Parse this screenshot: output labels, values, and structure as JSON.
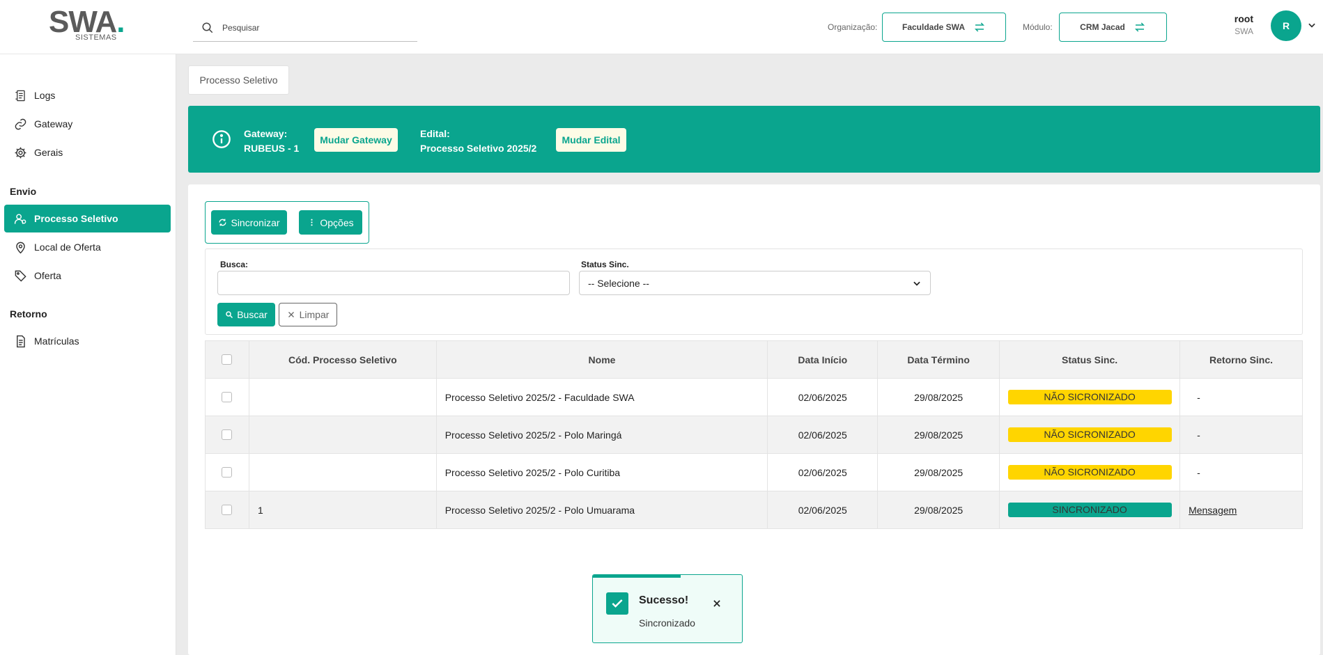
{
  "header": {
    "logo_text": "SWA",
    "logo_sub": "SISTEMAS",
    "search_placeholder": "Pesquisar",
    "org_label": "Organização:",
    "org_value": "Faculdade SWA",
    "module_label": "Módulo:",
    "module_value": "CRM Jacad",
    "user_name": "root",
    "user_org": "SWA",
    "avatar_initial": "R"
  },
  "sidebar": {
    "items_top": [
      {
        "label": "Logs",
        "icon": "logs-icon"
      },
      {
        "label": "Gateway",
        "icon": "link-icon"
      },
      {
        "label": "Gerais",
        "icon": "gear-icon"
      }
    ],
    "section_envio": "Envio",
    "items_envio": [
      {
        "label": "Processo Seletivo",
        "icon": "users-icon",
        "active": true
      },
      {
        "label": "Local de Oferta",
        "icon": "location-icon"
      },
      {
        "label": "Oferta",
        "icon": "tag-icon"
      }
    ],
    "section_retorno": "Retorno",
    "items_retorno": [
      {
        "label": "Matrículas",
        "icon": "document-icon"
      }
    ]
  },
  "main": {
    "tab_label": "Processo Seletivo",
    "banner": {
      "gateway_label": "Gateway:",
      "gateway_value": "RUBEUS - 1",
      "change_gateway": "Mudar Gateway",
      "edital_label": "Edital:",
      "edital_value": "Processo Seletivo 2025/2",
      "change_edital": "Mudar Edital"
    },
    "toolbar": {
      "sync_label": "Sincronizar",
      "options_label": "Opções"
    },
    "filter": {
      "search_label": "Busca:",
      "search_value": "",
      "status_label": "Status Sinc.",
      "status_value": "-- Selecione --",
      "search_button": "Buscar",
      "clear_button": "Limpar"
    },
    "table": {
      "columns": [
        "Cód. Processo Seletivo",
        "Nome",
        "Data Início",
        "Data Término",
        "Status Sinc.",
        "Retorno Sinc."
      ],
      "rows": [
        {
          "code": "",
          "name": "Processo Seletivo 2025/2 - Faculdade SWA",
          "start": "02/06/2025",
          "end": "29/08/2025",
          "status": "NÃO SICRONIZADO",
          "return": "-"
        },
        {
          "code": "",
          "name": "Processo Seletivo 2025/2 - Polo Maringá",
          "start": "02/06/2025",
          "end": "29/08/2025",
          "status": "NÃO SICRONIZADO",
          "return": "-"
        },
        {
          "code": "",
          "name": "Processo Seletivo 2025/2 - Polo Curitiba",
          "start": "02/06/2025",
          "end": "29/08/2025",
          "status": "NÃO SICRONIZADO",
          "return": "-"
        },
        {
          "code": "1",
          "name": "Processo Seletivo 2025/2 - Polo Umuarama",
          "start": "02/06/2025",
          "end": "29/08/2025",
          "status": "SINCRONIZADO",
          "return": "Mensagem"
        }
      ]
    }
  },
  "toast": {
    "title": "Sucesso!",
    "message": "Sincronizado",
    "progress": 0.59
  },
  "colors": {
    "accent": "#0aa58e",
    "warning": "#ffd500",
    "button_light": "#fdfbe6"
  }
}
